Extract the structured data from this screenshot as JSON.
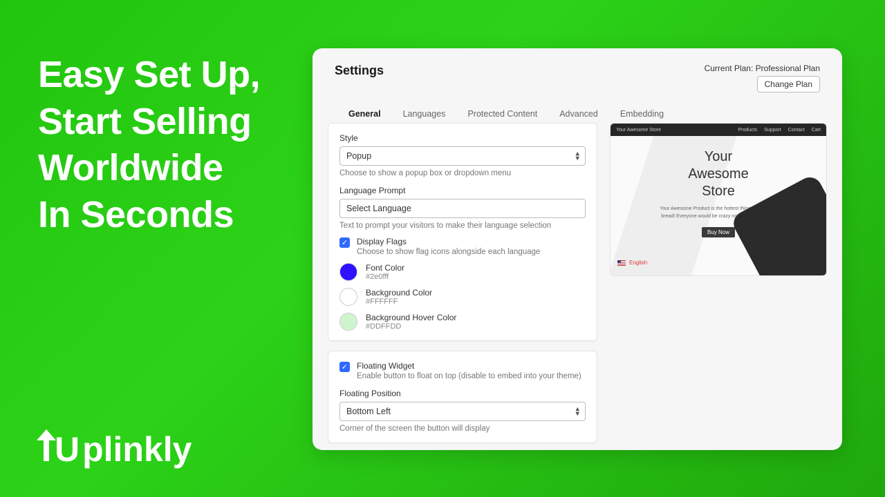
{
  "hero": {
    "line1": "Easy Set Up,",
    "line2": "Start Selling",
    "line3": "Worldwide",
    "line4": "In Seconds"
  },
  "logo": {
    "text": "plinkly"
  },
  "header": {
    "title": "Settings"
  },
  "plan": {
    "line": "Current Plan: Professional Plan",
    "button": "Change Plan"
  },
  "tabs": {
    "t0": "General",
    "t1": "Languages",
    "t2": "Protected Content",
    "t3": "Advanced",
    "t4": "Embedding"
  },
  "style": {
    "label": "Style",
    "value": "Popup",
    "help": "Choose to show a popup box or dropdown menu"
  },
  "prompt": {
    "label": "Language Prompt",
    "value": "Select Language",
    "help": "Text to prompt your visitors to make their language selection"
  },
  "flags": {
    "label": "Display Flags",
    "help": "Choose to show flag icons alongside each language"
  },
  "fontcolor": {
    "label": "Font Color",
    "value": "#2e0fff",
    "swatch": "#2e0fff"
  },
  "bgcolor": {
    "label": "Background Color",
    "value": "#FFFFFF",
    "swatch": "#FFFFFF"
  },
  "hovercolor": {
    "label": "Background Hover Color",
    "value": "#DDFFDD",
    "swatch": "#CFF5CF"
  },
  "floating": {
    "label": "Floating Widget",
    "help": "Enable button to float on top (disable to embed into your theme)"
  },
  "floatpos": {
    "label": "Floating Position",
    "value": "Bottom Left",
    "help": "Corner of the screen the button will display"
  },
  "preview": {
    "store": "Your Awesome Store",
    "nav0": "Products",
    "nav1": "Support",
    "nav2": "Contact",
    "nav3": "Cart",
    "title1": "Your",
    "title2": "Awesome",
    "title3": "Store",
    "desc": "Your Awesome Product is the hottest thing since sliced bread! Everyone would be crazy not to get one today.",
    "buy": "Buy Now",
    "lang": "English"
  }
}
